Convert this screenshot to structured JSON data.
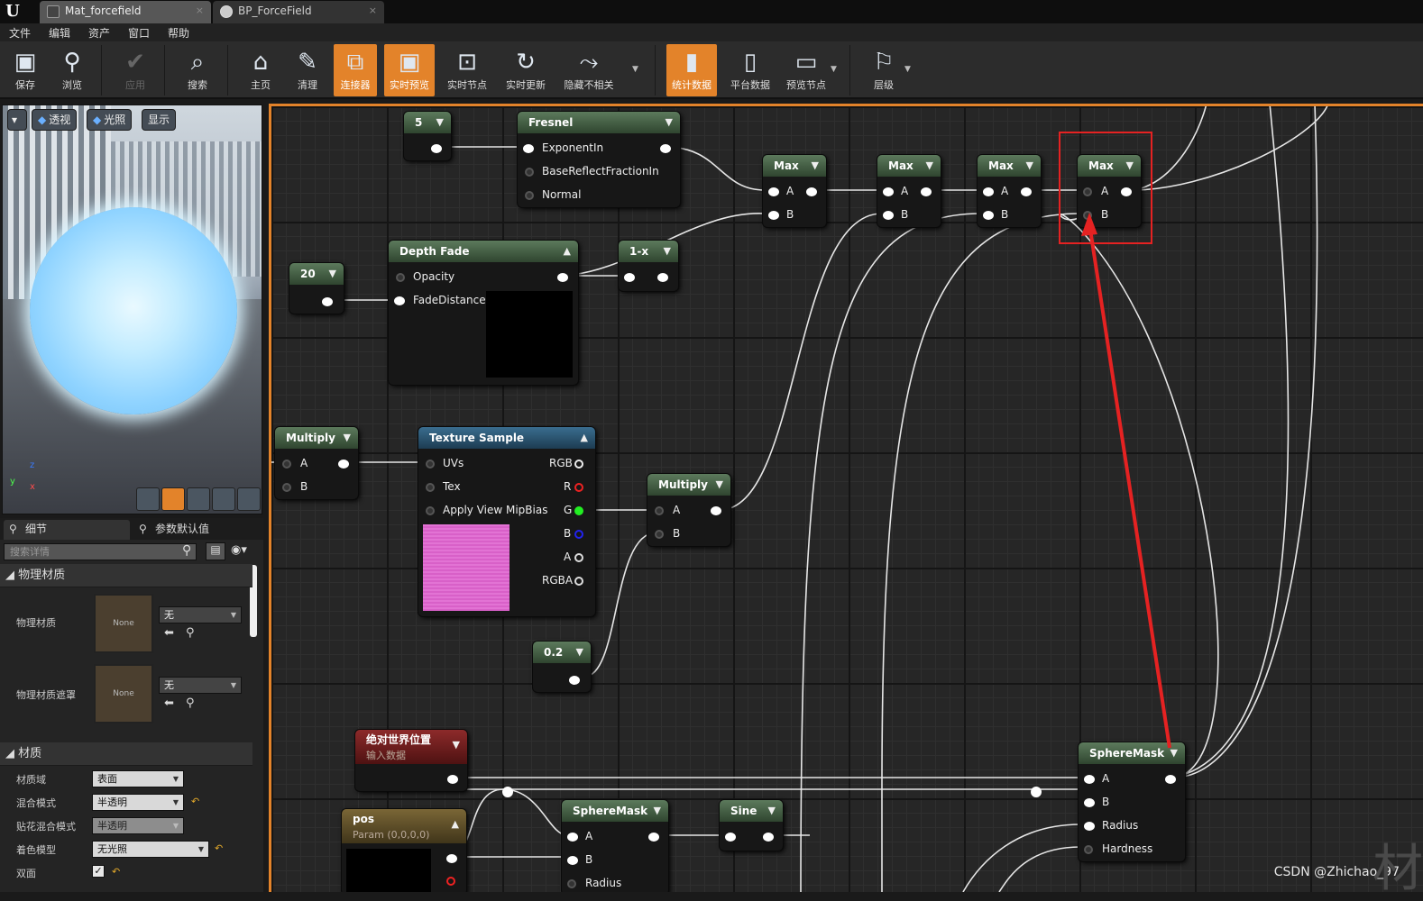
{
  "tabs": [
    {
      "label": "Mat_forcefield"
    },
    {
      "label": "BP_ForceField"
    }
  ],
  "menu": [
    "文件",
    "编辑",
    "资产",
    "窗口",
    "帮助"
  ],
  "toolbar": [
    {
      "label": "保存",
      "icon": "save-icon",
      "active": false
    },
    {
      "label": "浏览",
      "icon": "browse-icon",
      "active": false
    },
    {
      "label": "应用",
      "icon": "apply-icon",
      "active": false,
      "disabled": true
    },
    {
      "label": "搜索",
      "icon": "search-icon",
      "active": false
    },
    {
      "label": "主页",
      "icon": "home-icon",
      "active": false
    },
    {
      "label": "清理",
      "icon": "clean-icon",
      "active": false
    },
    {
      "label": "连接器",
      "icon": "connector-icon",
      "active": true
    },
    {
      "label": "实时预览",
      "icon": "live-preview-icon",
      "active": true
    },
    {
      "label": "实时节点",
      "icon": "live-nodes-icon",
      "active": false
    },
    {
      "label": "实时更新",
      "icon": "live-update-icon",
      "active": false
    },
    {
      "label": "隐藏不相关",
      "icon": "hide-unrelated-icon",
      "active": false
    },
    {
      "label": "统计数据",
      "icon": "stats-icon",
      "active": true
    },
    {
      "label": "平台数据",
      "icon": "platform-stats-icon",
      "active": false
    },
    {
      "label": "预览节点",
      "icon": "preview-node-icon",
      "active": false
    },
    {
      "label": "层级",
      "icon": "hierarchy-icon",
      "active": false
    }
  ],
  "viewport": {
    "buttons": [
      "透视",
      "光照",
      "显示"
    ]
  },
  "details": {
    "tabs": [
      "细节",
      "参数默认值"
    ],
    "search_placeholder": "搜索详情",
    "section_physical": "物理材质",
    "phys_material_label": "物理材质",
    "phys_mask_label": "物理材质遮罩",
    "none_thumb": "None",
    "none_value": "无",
    "section_material": "材质",
    "rows": [
      {
        "label": "材质域",
        "value": "表面"
      },
      {
        "label": "混合模式",
        "value": "半透明"
      },
      {
        "label": "贴花混合模式",
        "value": "半透明"
      },
      {
        "label": "着色模型",
        "value": "无光照"
      },
      {
        "label": "双面",
        "value": "✓"
      }
    ]
  },
  "nodes": {
    "const5": {
      "value": "5"
    },
    "fresnel": {
      "title": "Fresnel",
      "pins": [
        "ExponentIn",
        "BaseReflectFractionIn",
        "Normal"
      ]
    },
    "max": {
      "title": "Max",
      "pinA": "A",
      "pinB": "B"
    },
    "const20": {
      "value": "20"
    },
    "depthfade": {
      "title": "Depth Fade",
      "pins": [
        "Opacity",
        "FadeDistance"
      ]
    },
    "oneminus": {
      "title": "1-x"
    },
    "multiply": {
      "title": "Multiply",
      "pinA": "A",
      "pinB": "B"
    },
    "texsample": {
      "title": "Texture Sample",
      "inputs": [
        "UVs",
        "Tex",
        "Apply View MipBias"
      ],
      "outputs": [
        "RGB",
        "R",
        "G",
        "B",
        "A",
        "RGBA"
      ]
    },
    "const02": {
      "value": "0.2"
    },
    "worldpos": {
      "title": "绝对世界位置",
      "subtitle": "输入数据"
    },
    "pos": {
      "title": "pos",
      "subtitle": "Param (0,0,0,0)"
    },
    "spheremask": {
      "title": "SphereMask",
      "pins": [
        "A",
        "B",
        "Radius",
        "Hardness"
      ]
    },
    "sine": {
      "title": "Sine"
    }
  },
  "watermark": "CSDN @Zhichao_97",
  "corner_text": "材"
}
